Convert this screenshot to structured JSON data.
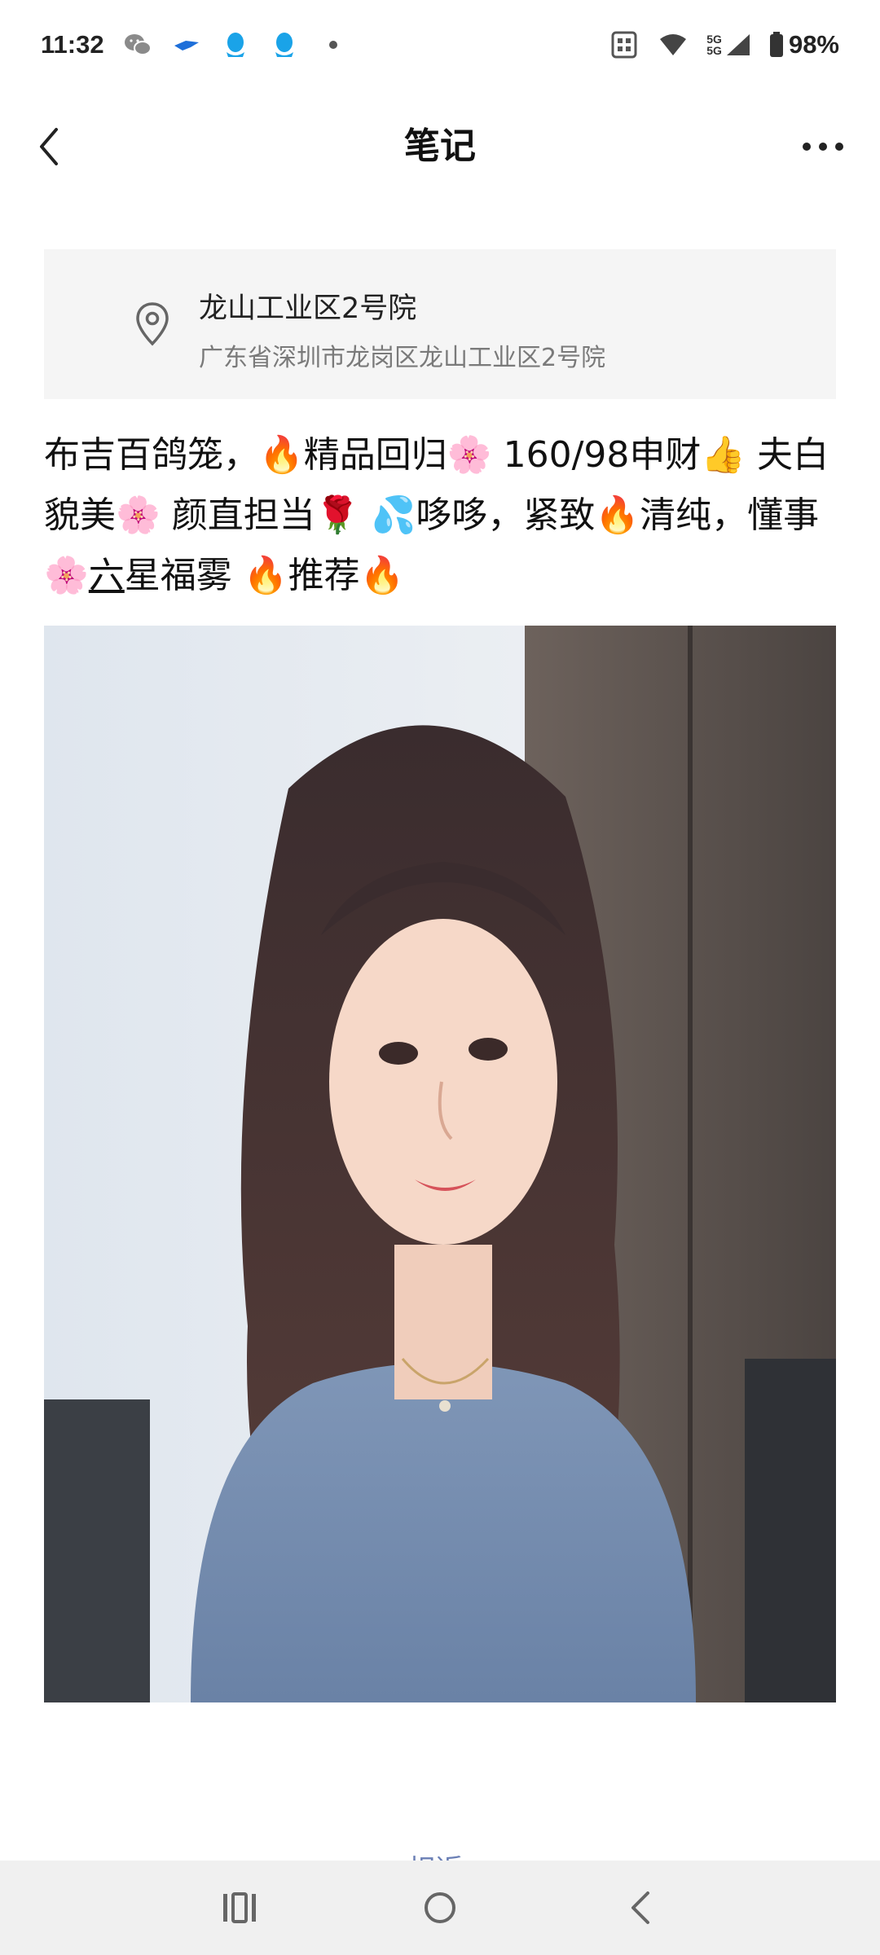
{
  "status_bar": {
    "time": "11:32",
    "left_icons": [
      "wechat-icon",
      "feishu-icon",
      "qq-icon",
      "qq-icon",
      "dot-icon"
    ],
    "network_label_top": "5G",
    "network_label_bottom": "5G",
    "battery": "98%"
  },
  "nav": {
    "title": "笔记"
  },
  "location": {
    "name": "龙山工业区2号院",
    "address": "广东省深圳市龙岗区龙山工业区2号院"
  },
  "note": {
    "seg1": "布吉百鸽笼，",
    "seg2": "精品回归",
    "seg3": " 160/98申财",
    "seg4": " 夫白貌美",
    "seg5": " 颜直担当",
    "seg6": " ",
    "seg7": "哆哆，紧致",
    "seg8": "清纯，懂事",
    "seg9": "六",
    "seg10": "星福雾 ",
    "seg11": "推荐",
    "emoji_fire": "🔥",
    "emoji_blossom": "🌸",
    "emoji_thumb": "👍",
    "emoji_rose": "🌹",
    "emoji_sweat": "💦"
  },
  "footer": {
    "partial_link": "相近"
  },
  "colors": {
    "card_bg": "#f5f5f5",
    "muted_text": "#7a7a7a",
    "link": "#6a7fb5",
    "system_nav_bg": "#f0f0f0"
  }
}
